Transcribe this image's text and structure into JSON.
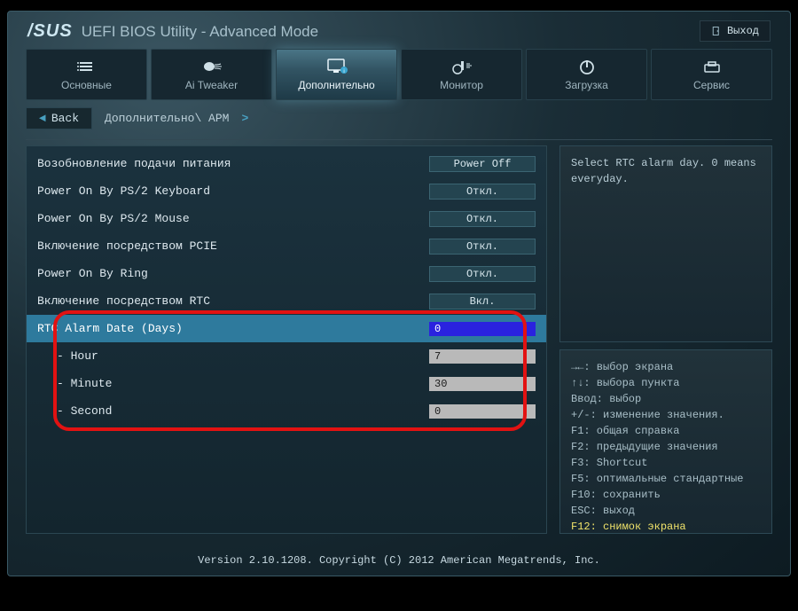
{
  "header": {
    "brand": "/SUS",
    "title": "UEFI BIOS Utility - Advanced Mode",
    "exit": "Выход"
  },
  "tabs": [
    {
      "key": "main",
      "label": "Основные"
    },
    {
      "key": "tweaker",
      "label": "Ai Tweaker"
    },
    {
      "key": "advanced",
      "label": "Дополнительно"
    },
    {
      "key": "monitor",
      "label": "Монитор"
    },
    {
      "key": "boot",
      "label": "Загрузка"
    },
    {
      "key": "tool",
      "label": "Сервис"
    }
  ],
  "breadcrumb": {
    "back": "Back",
    "path": "Дополнительно\\ APM"
  },
  "settings": [
    {
      "label": "Возобновление подачи питания",
      "type": "dropdown",
      "value": "Power Off"
    },
    {
      "label": "Power On By PS/2 Keyboard",
      "type": "dropdown",
      "value": "Откл."
    },
    {
      "label": "Power On By PS/2 Mouse",
      "type": "dropdown",
      "value": "Откл."
    },
    {
      "label": "Включение посредством PCIE",
      "type": "dropdown",
      "value": "Откл."
    },
    {
      "label": "Power On By Ring",
      "type": "dropdown",
      "value": "Откл."
    },
    {
      "label": "Включение посредством RTC",
      "type": "dropdown",
      "value": "Вкл."
    },
    {
      "label": "RTC Alarm Date (Days)",
      "type": "input",
      "value": "0",
      "selected": true
    },
    {
      "label": "- Hour",
      "type": "input",
      "value": "7",
      "indent": true
    },
    {
      "label": "- Minute",
      "type": "input",
      "value": "30",
      "indent": true
    },
    {
      "label": "- Second",
      "type": "input",
      "value": "0",
      "indent": true
    }
  ],
  "help": "Select RTC alarm day. 0 means everyday.",
  "legend": [
    "→←: выбор экрана",
    "↑↓: выбора пункта",
    "Ввод: выбор",
    "+/-: изменение значения.",
    "F1: общая справка",
    "F2: предыдущие значения",
    "F3: Shortcut",
    "F5: оптимальные стандартные",
    "F10: сохранить",
    "ESC: выход",
    "F12: снимок экрана"
  ],
  "footer": "Version 2.10.1208. Copyright (C) 2012 American Megatrends, Inc."
}
